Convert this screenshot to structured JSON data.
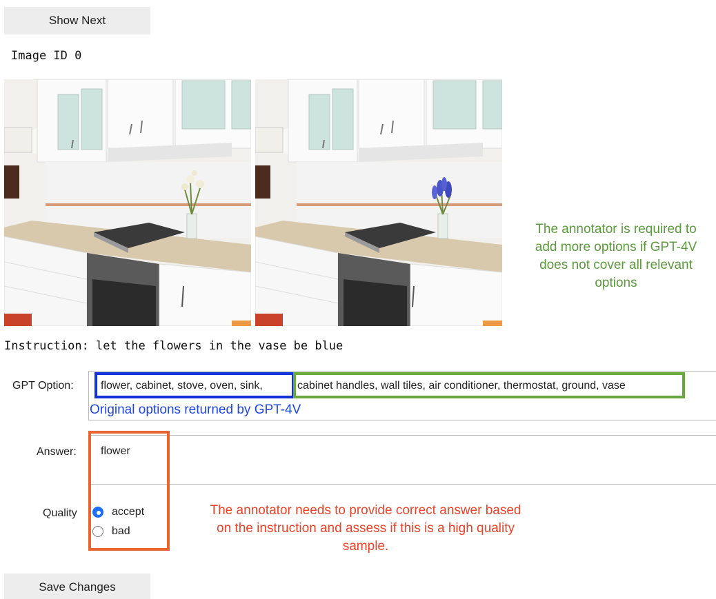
{
  "buttons": {
    "show_next": "Show Next",
    "save_changes": "Save Changes"
  },
  "image_id_text": "Image ID 0",
  "images": {
    "left": "kitchen-with-white-flowers",
    "right": "kitchen-with-blue-flowers"
  },
  "instruction_text": "Instruction: let the flowers in the vase be blue",
  "gpt_option": {
    "label": "GPT Option:",
    "original_options": "flower, cabinet, stove, oven, sink,",
    "added_options": "cabinet handles, wall tiles, air conditioner, thermostat, ground, vase",
    "caption": "Original options returned by GPT-4V"
  },
  "answer": {
    "label": "Answer:",
    "value": "flower"
  },
  "quality": {
    "label": "Quality",
    "options": [
      "accept",
      "bad"
    ],
    "selected": "accept"
  },
  "notes": {
    "green": "The annotator is required to add more options if GPT-4V does not cover all relevant options",
    "red": "The annotator needs to provide correct answer based on the instruction and assess if this is a high quality sample."
  },
  "colors": {
    "blue_box": "#1432d8",
    "green_box": "#6aa83e",
    "orange_box": "#ea6430",
    "green_note": "#5a9a3c",
    "red_note": "#e8442a",
    "radio_selected": "#1a6ef5"
  }
}
